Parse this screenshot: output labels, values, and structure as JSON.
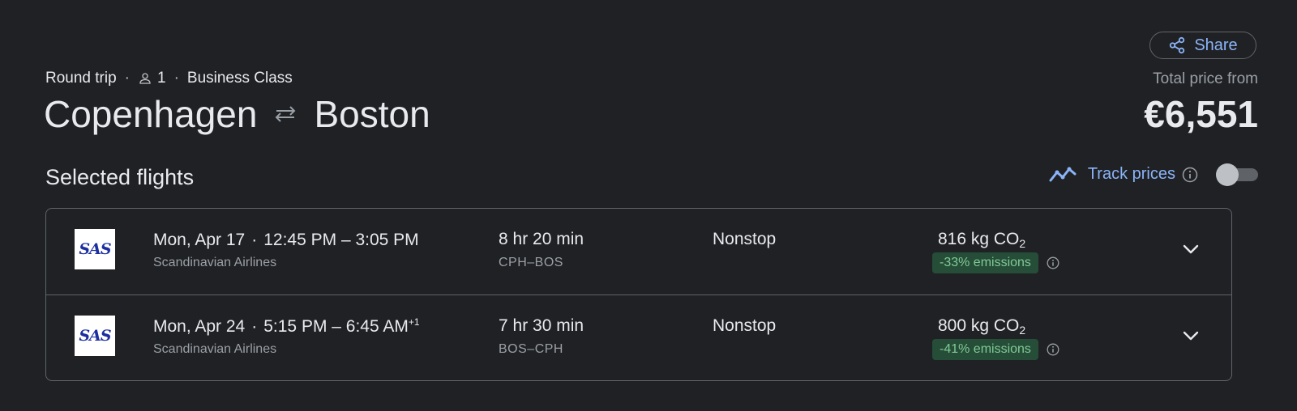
{
  "header": {
    "share_label": "Share",
    "trip_type": "Round trip",
    "passengers": "1",
    "cabin_class": "Business Class",
    "origin": "Copenhagen",
    "destination": "Boston",
    "price_label": "Total price from",
    "price": "€6,551"
  },
  "selected": {
    "title": "Selected flights",
    "track_label": "Track prices",
    "track_enabled": false
  },
  "flights": [
    {
      "logo_text": "SAS",
      "date": "Mon, Apr 17",
      "times": "12:45 PM – 3:05 PM",
      "day_offset": "",
      "airline": "Scandinavian Airlines",
      "duration": "8 hr 20 min",
      "airports": "CPH–BOS",
      "stops": "Nonstop",
      "co2_amount": "816 kg CO",
      "co2_sub": "2",
      "emissions": "-33% emissions"
    },
    {
      "logo_text": "SAS",
      "date": "Mon, Apr 24",
      "times": "5:15 PM – 6:45 AM",
      "day_offset": "+1",
      "airline": "Scandinavian Airlines",
      "duration": "7 hr 30 min",
      "airports": "BOS–CPH",
      "stops": "Nonstop",
      "co2_amount": "800 kg CO",
      "co2_sub": "2",
      "emissions": "-41% emissions"
    }
  ],
  "icons": {
    "share": "share-icon",
    "person": "person-icon",
    "swap": "swap-arrows-icon",
    "trend": "trend-line-icon",
    "info": "info-icon",
    "chevron": "chevron-down-icon"
  },
  "colors": {
    "background": "#202124",
    "accent": "#8ab4f8",
    "emissions_badge_bg": "#254d38",
    "emissions_badge_text": "#81c995"
  }
}
